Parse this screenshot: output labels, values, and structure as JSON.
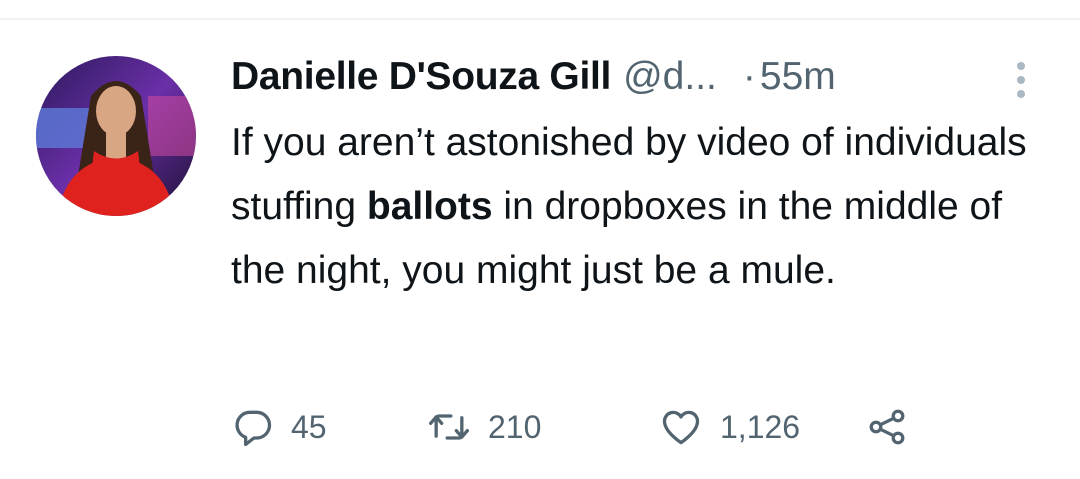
{
  "tweet": {
    "display_name": "Danielle D'Souza Gill",
    "handle": "@d...",
    "separator": "·",
    "time": "55m",
    "text_part1": "If you aren’t astonished by video of individuals stuffing ",
    "text_bold": "ballots",
    "text_part2": " in dropboxes in the middle of the night, you might just be a mule.",
    "actions": {
      "reply_count": "45",
      "retweet_count": "210",
      "like_count": "1,126"
    },
    "icons": {
      "reply": "reply-icon",
      "retweet": "retweet-icon",
      "like": "heart-icon",
      "share": "share-icon",
      "more": "more-vertical-icon"
    },
    "colors": {
      "text": "#0f1419",
      "secondary": "#536471",
      "divider": "#eff3f4"
    }
  }
}
